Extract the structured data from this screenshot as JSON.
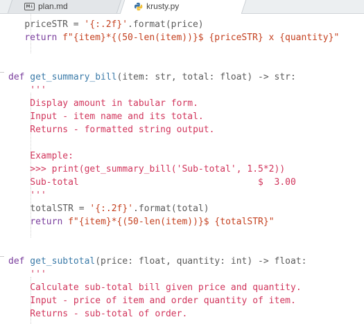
{
  "tabs": [
    {
      "label": "plan.md",
      "icon": "markdown-icon",
      "active": false
    },
    {
      "label": "krusty.py",
      "icon": "python-icon",
      "active": true
    }
  ],
  "colors": {
    "keyword": "#7a3e9d",
    "function": "#3a7aa8",
    "string": "#c4401f",
    "docstring": "#d1345b",
    "plain": "#5a5a5a"
  },
  "code": {
    "l1": {
      "indent": "    ",
      "var": "priceSTR",
      "eq": " = ",
      "str": "'{:.2f}'",
      "rest": ".format(price)"
    },
    "l2": {
      "indent": "    ",
      "kw": "return",
      "sp": " ",
      "fstr": "f\"{item}*{(50-len(item))}$ {priceSTR} x {quantity}\""
    },
    "l5": {
      "def": "def",
      "name": " get_summary_bill",
      "args": "(item: str, total: float) -> str:"
    },
    "l6": "    '''",
    "l7": "    Display amount in tabular form.",
    "l8": "    Input - item name and its total.",
    "l9": "    Returns - formatted string output.",
    "l11": "    Example:",
    "l12": "    >>> print(get_summary_bill('Sub-total', 1.5*2))",
    "l13": "    Sub-total                                 $  3.00",
    "l14": "    '''",
    "l15": {
      "indent": "    ",
      "var": "totalSTR",
      "eq": " = ",
      "str": "'{:.2f}'",
      "rest": ".format(total)"
    },
    "l16": {
      "indent": "    ",
      "kw": "return",
      "sp": " ",
      "fstr": "f\"{item}*{(50-len(item))}$ {totalSTR}\""
    },
    "l19": {
      "def": "def",
      "name": " get_subtotal",
      "args": "(price: float, quantity: int) -> float:"
    },
    "l20": "    '''",
    "l21": "    Calculate sub-total bill given price and quantity.",
    "l22": "    Input - price of item and order quantity of item.",
    "l23": "    Returns - sub-total of order."
  }
}
